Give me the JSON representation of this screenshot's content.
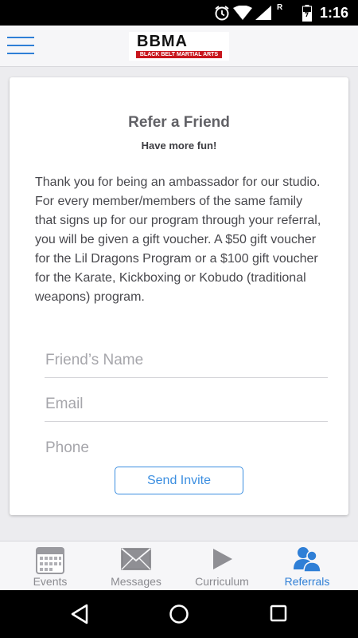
{
  "status_bar": {
    "time": "1:16",
    "icons": [
      "alarm-clock-icon",
      "wifi-icon",
      "signal-roaming-icon",
      "battery-icon"
    ],
    "roaming_label": "R"
  },
  "header": {
    "menu_icon": "hamburger-menu-icon",
    "logo_text": "BBMA",
    "logo_subtitle": "BLACK BELT MARTIAL ARTS",
    "accent_color": "#2f7fd6"
  },
  "referral": {
    "title": "Refer a Friend",
    "subtitle": "Have more fun!",
    "description": "Thank you for being an ambassador for our studio. For every member/members of the same family that signs up for our program through your referral, you will be given a gift voucher. A $50 gift voucher for the Lil Dragons Program or a $100 gift voucher for the Karate, Kickboxing or Kobudo (traditional weapons) program.",
    "fields": {
      "name": {
        "placeholder": "Friend’s Name",
        "value": ""
      },
      "email": {
        "placeholder": "Email",
        "value": ""
      },
      "phone": {
        "placeholder": "Phone",
        "value": ""
      }
    },
    "send_label": "Send Invite"
  },
  "tabs": [
    {
      "label": "Events",
      "icon": "calendar-icon",
      "active": false
    },
    {
      "label": "Messages",
      "icon": "envelope-icon",
      "active": false
    },
    {
      "label": "Curriculum",
      "icon": "play-icon",
      "active": false
    },
    {
      "label": "Referrals",
      "icon": "people-icon",
      "active": true
    }
  ],
  "nav_bar": {
    "icons": [
      "back-icon",
      "home-icon",
      "recents-icon"
    ]
  }
}
